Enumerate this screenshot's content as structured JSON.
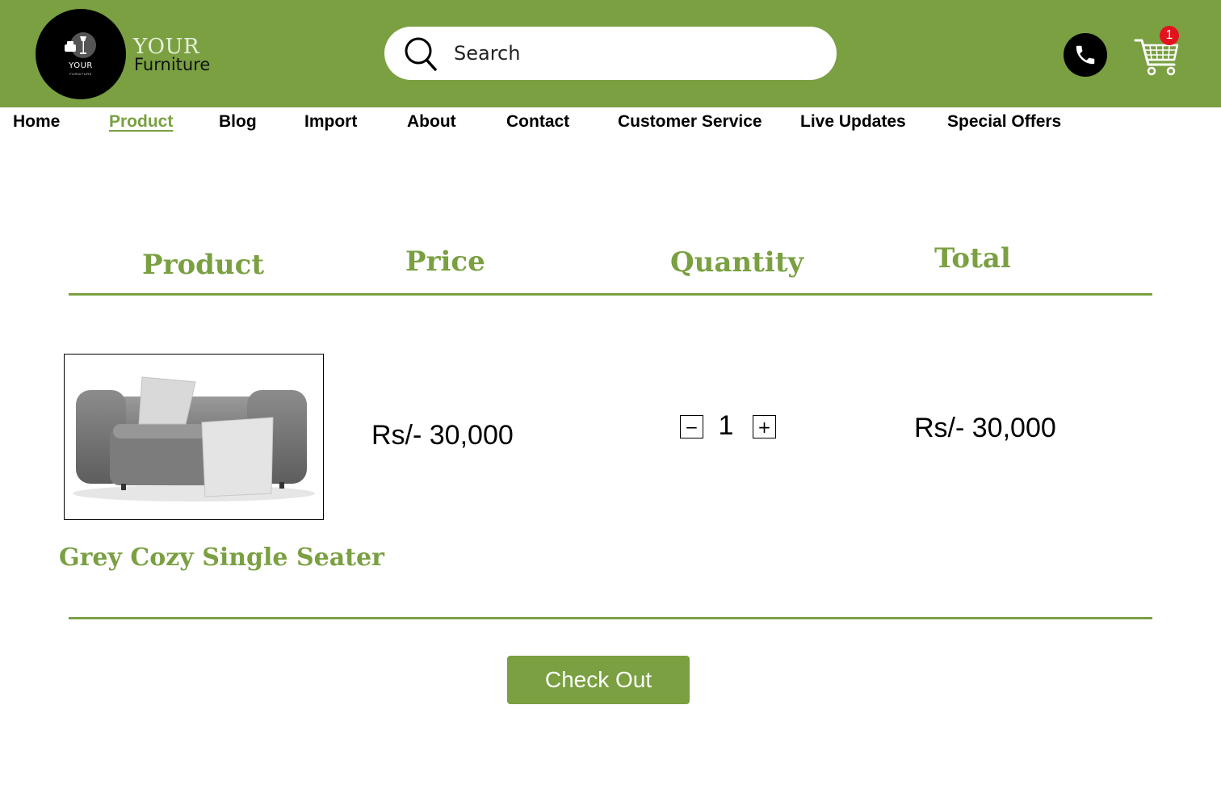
{
  "brand": {
    "logo_text": "YOUR",
    "logo_subtext": "FURNITURE",
    "name_top": "YOUR",
    "name_bottom": "Furniture"
  },
  "search": {
    "placeholder": "Search"
  },
  "header_icons": {
    "phone": "phone-icon",
    "cart": "cart-icon",
    "cart_count": "1"
  },
  "nav": {
    "items": [
      "Home",
      "Product",
      "Blog",
      "Import",
      "About",
      "Contact",
      "Customer Service",
      "Live Updates",
      "Special Offers"
    ],
    "active": "Product"
  },
  "cart_table": {
    "headers": {
      "product": "Product",
      "price": "Price",
      "quantity": "Quantity",
      "total": "Total"
    },
    "items": [
      {
        "name": "Grey Cozy Single Seater",
        "price": "Rs/- 30,000",
        "quantity": "1",
        "total": "Rs/- 30,000"
      }
    ]
  },
  "qty_controls": {
    "decrement": "−",
    "increment": "+"
  },
  "checkout_label": "Check Out",
  "colors": {
    "brand_green": "#7aa042",
    "badge_red": "#e3131e"
  }
}
